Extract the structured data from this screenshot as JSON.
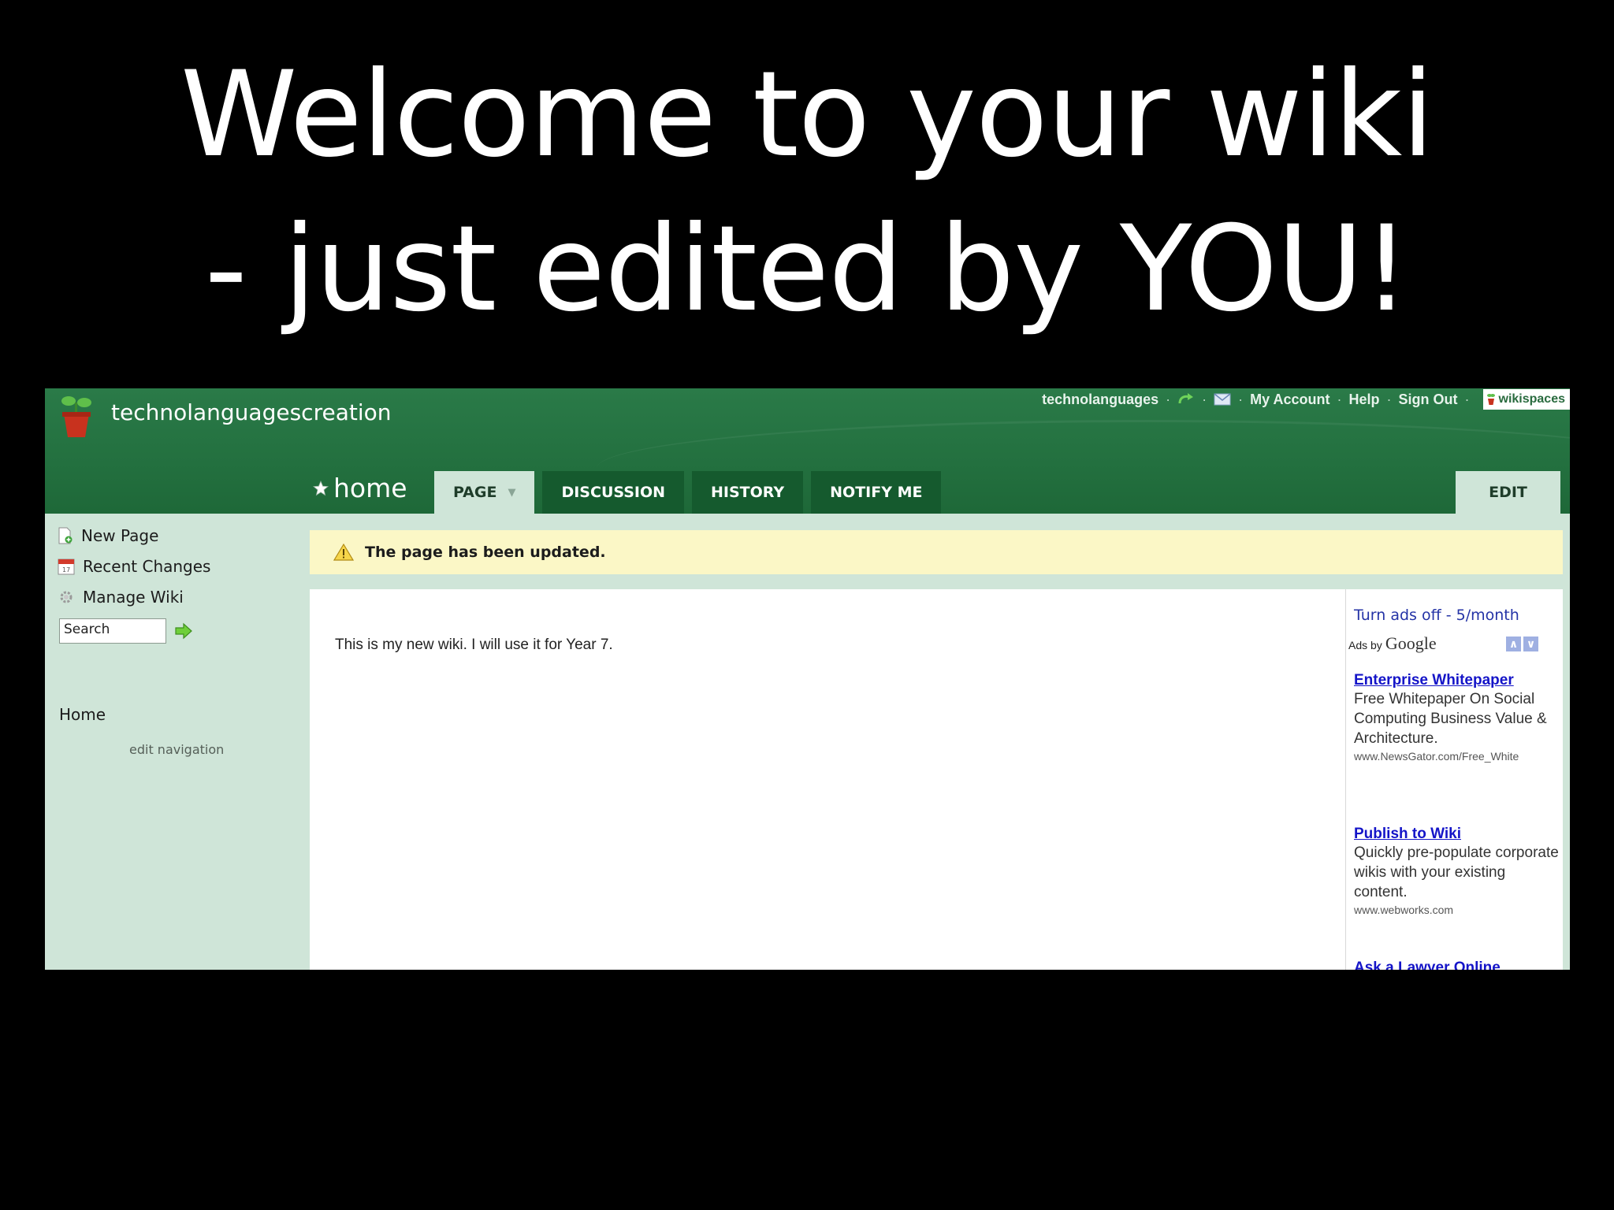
{
  "slide": {
    "title_line1": "Welcome to your wiki",
    "title_line2": "- just edited by YOU!"
  },
  "header": {
    "site_name": "technolanguagescreation",
    "username": "technolanguages",
    "my_account": "My Account",
    "help": "Help",
    "sign_out": "Sign Out",
    "brand": "wikispaces"
  },
  "page": {
    "name": "home",
    "tabs": [
      {
        "label": "PAGE"
      },
      {
        "label": "DISCUSSION"
      },
      {
        "label": "HISTORY"
      },
      {
        "label": "NOTIFY ME"
      }
    ],
    "edit_label": "EDIT"
  },
  "sidebar": {
    "new_page": "New Page",
    "recent_changes": "Recent Changes",
    "manage_wiki": "Manage Wiki",
    "search_value": "Search",
    "nav_home": "Home",
    "edit_navigation": "edit navigation"
  },
  "notice": "The page has been updated.",
  "content": {
    "body": "This is my new wiki. I will use it for Year 7."
  },
  "ads": {
    "turn_off": "Turn ads off - 5/month",
    "ads_by": "Ads by",
    "google": "Google",
    "items": [
      {
        "title": "Enterprise Whitepaper",
        "desc": "Free Whitepaper On Social Computing Business Value & Architecture.",
        "url": "www.NewsGator.com/Free_White"
      },
      {
        "title": "Publish to Wiki",
        "desc": "Quickly pre-populate corporate wikis with your existing content.",
        "url": "www.webworks.com"
      },
      {
        "title": "Ask a Lawyer Online"
      }
    ]
  },
  "colors": {
    "header_green": "#23703f",
    "tab_green": "#155a2e",
    "sidebar_bg": "#cfe5d8",
    "notice_bg": "#fbf7c6",
    "ad_link": "#1414c8"
  }
}
